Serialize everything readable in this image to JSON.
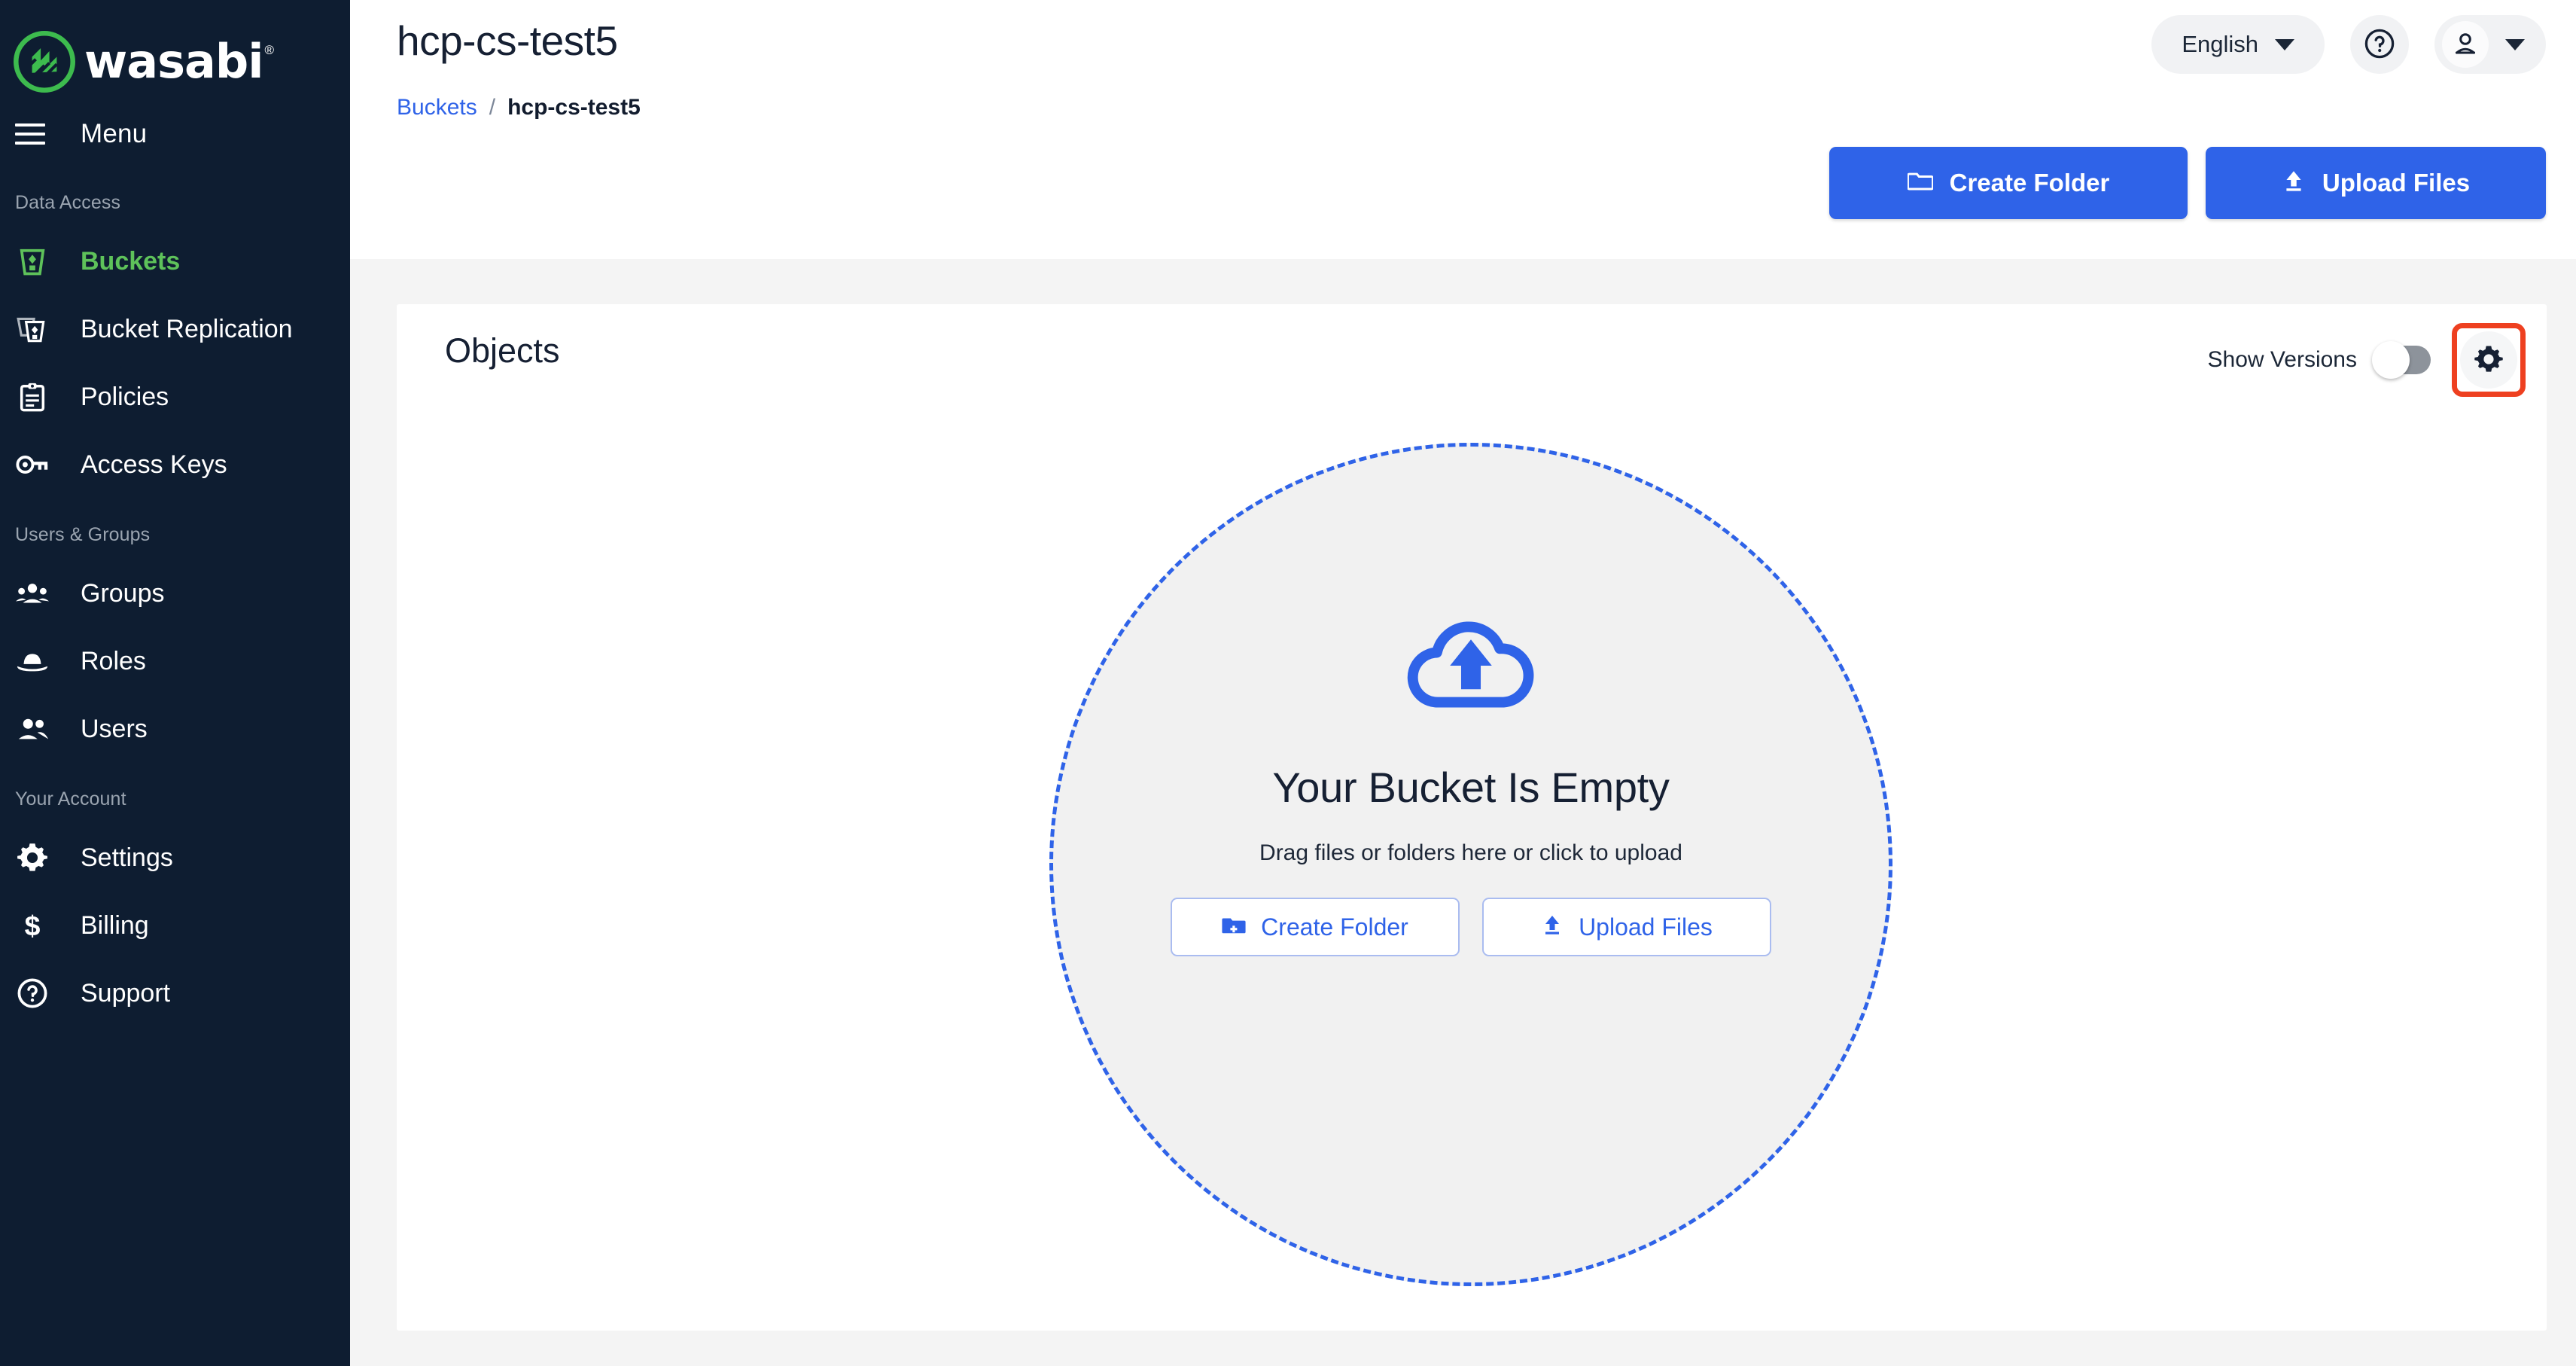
{
  "brand": {
    "name": "wasabi",
    "registered": "®",
    "logo_green": "#3dbb4e",
    "sidebar_bg": "#0e1d31"
  },
  "sidebar": {
    "menu_label": "Menu",
    "sections": [
      {
        "label": "Data Access",
        "items": [
          {
            "label": "Buckets",
            "icon": "bucket-icon",
            "active": true
          },
          {
            "label": "Bucket Replication",
            "icon": "bucket-replication-icon",
            "active": false
          },
          {
            "label": "Policies",
            "icon": "clipboard-icon",
            "active": false
          },
          {
            "label": "Access Keys",
            "icon": "key-icon",
            "active": false
          }
        ]
      },
      {
        "label": "Users & Groups",
        "items": [
          {
            "label": "Groups",
            "icon": "groups-icon",
            "active": false
          },
          {
            "label": "Roles",
            "icon": "hat-icon",
            "active": false
          },
          {
            "label": "Users",
            "icon": "users-icon",
            "active": false
          }
        ]
      },
      {
        "label": "Your Account",
        "items": [
          {
            "label": "Settings",
            "icon": "gear-icon",
            "active": false
          },
          {
            "label": "Billing",
            "icon": "dollar-icon",
            "active": false
          },
          {
            "label": "Support",
            "icon": "question-circle-icon",
            "active": false
          }
        ]
      }
    ]
  },
  "header": {
    "title": "hcp-cs-test5",
    "breadcrumb": {
      "root": "Buckets",
      "separator": "/",
      "current": "hcp-cs-test5"
    },
    "language": {
      "selected": "English",
      "icon": "chevron-down-icon"
    },
    "help_icon": "question-circle-icon",
    "account_icon": "person-icon",
    "account_caret_icon": "chevron-down-icon"
  },
  "actions": {
    "create_folder": "Create Folder",
    "create_folder_icon": "folder-icon",
    "upload_files": "Upload Files",
    "upload_files_icon": "upload-icon"
  },
  "panel": {
    "title": "Objects",
    "show_versions_label": "Show Versions",
    "show_versions_on": false,
    "settings_icon": "gear-icon",
    "settings_highlight_color": "#ee4020"
  },
  "empty_state": {
    "icon": "cloud-upload-icon",
    "title": "Your Bucket Is Empty",
    "subtitle": "Drag files or folders here or click to upload",
    "create_folder": "Create Folder",
    "create_folder_icon": "folder-add-icon",
    "upload_files": "Upload Files",
    "upload_files_icon": "upload-icon"
  },
  "colors": {
    "primary_blue": "#2f63e8",
    "accent_green": "#5ec25a",
    "page_bg": "#f4f4f4",
    "panel_bg": "#ffffff",
    "dropzone_fill": "#f1f1f1"
  }
}
